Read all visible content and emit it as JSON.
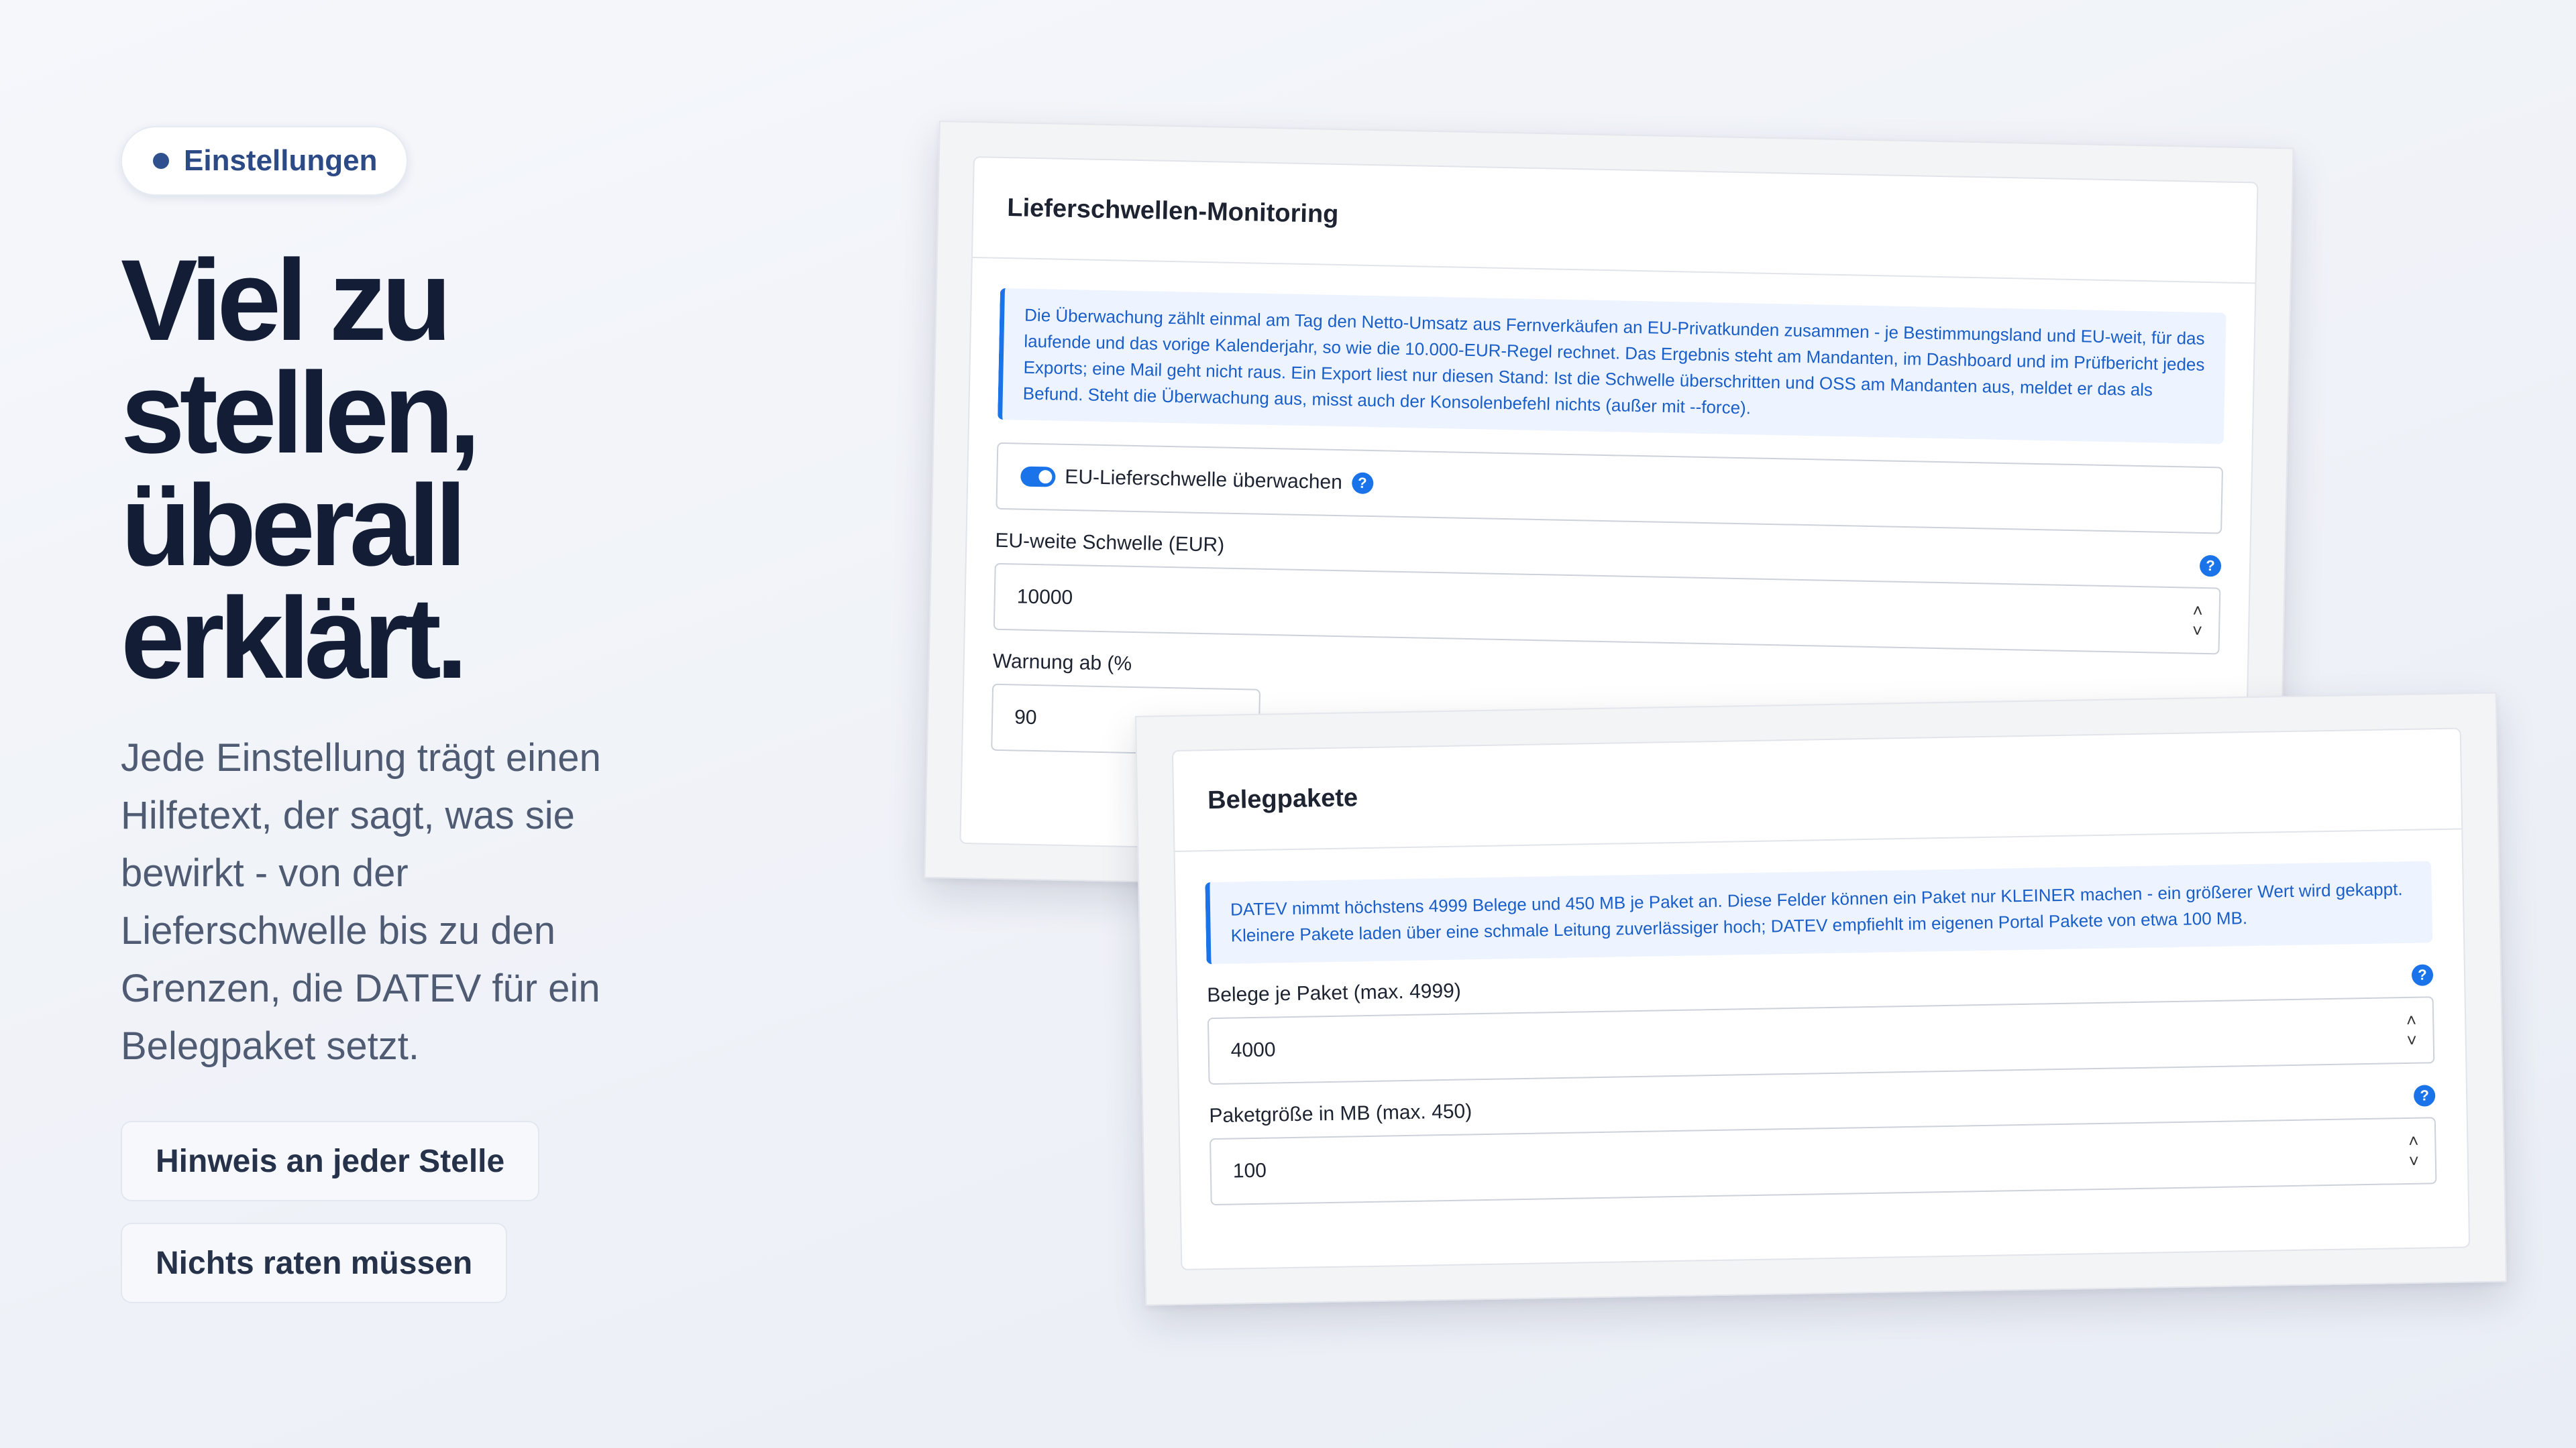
{
  "badge": {
    "label": "Einstellungen"
  },
  "headline": [
    "Viel zu",
    "stellen,",
    "überall",
    "erklärt."
  ],
  "lead": "Jede Einstellung trägt einen Hilfetext, der sagt, was sie bewirkt - von der Lieferschwelle bis zu den Grenzen, die DATEV für ein Belegpaket setzt.",
  "tags": [
    "Hinweis an jeder Stelle",
    "Nichts raten müssen"
  ],
  "colors": {
    "accent": "#1a73e8",
    "headline": "#131e36",
    "badge_dot": "#2f4f8f"
  },
  "card1": {
    "title": "Lieferschwellen-Monitoring",
    "info": "Die Überwachung zählt einmal am Tag den Netto-Umsatz aus Fernverkäufen an EU-Privatkunden zusammen - je Bestimmungsland und EU-weit, für das laufende und das vorige Kalenderjahr, so wie die 10.000-EUR-Regel rechnet. Das Ergebnis steht am Mandanten, im Dashboard und im Prüfbericht jedes Exports; eine Mail geht nicht raus. Ein Export liest nur diesen Stand: Ist die Schwelle überschritten und OSS am Mandanten aus, meldet er das als Befund. Steht die Überwachung aus, misst auch der Konsolenbefehl nichts (außer mit --force).",
    "toggle_label": "EU-Lieferschwelle überwachen",
    "toggle_on": true,
    "threshold_label": "EU-weite Schwelle (EUR)",
    "threshold_value": "10000",
    "warning_label": "Warnung ab (%",
    "warning_value": "90",
    "help_glyph": "?",
    "spin_up": "˄",
    "spin_down": "˅"
  },
  "card2": {
    "title": "Belegpakete",
    "info": "DATEV nimmt höchstens 4999 Belege und 450 MB je Paket an. Diese Felder können ein Paket nur KLEINER machen - ein größerer Wert wird gekappt. Kleinere Pakete laden über eine schmale Leitung zuverlässiger hoch; DATEV empfiehlt im eigenen Portal Pakete von etwa 100 MB.",
    "docs_label": "Belege je Paket (max. 4999)",
    "docs_value": "4000",
    "size_label": "Paketgröße in MB (max. 450)",
    "size_value": "100"
  }
}
